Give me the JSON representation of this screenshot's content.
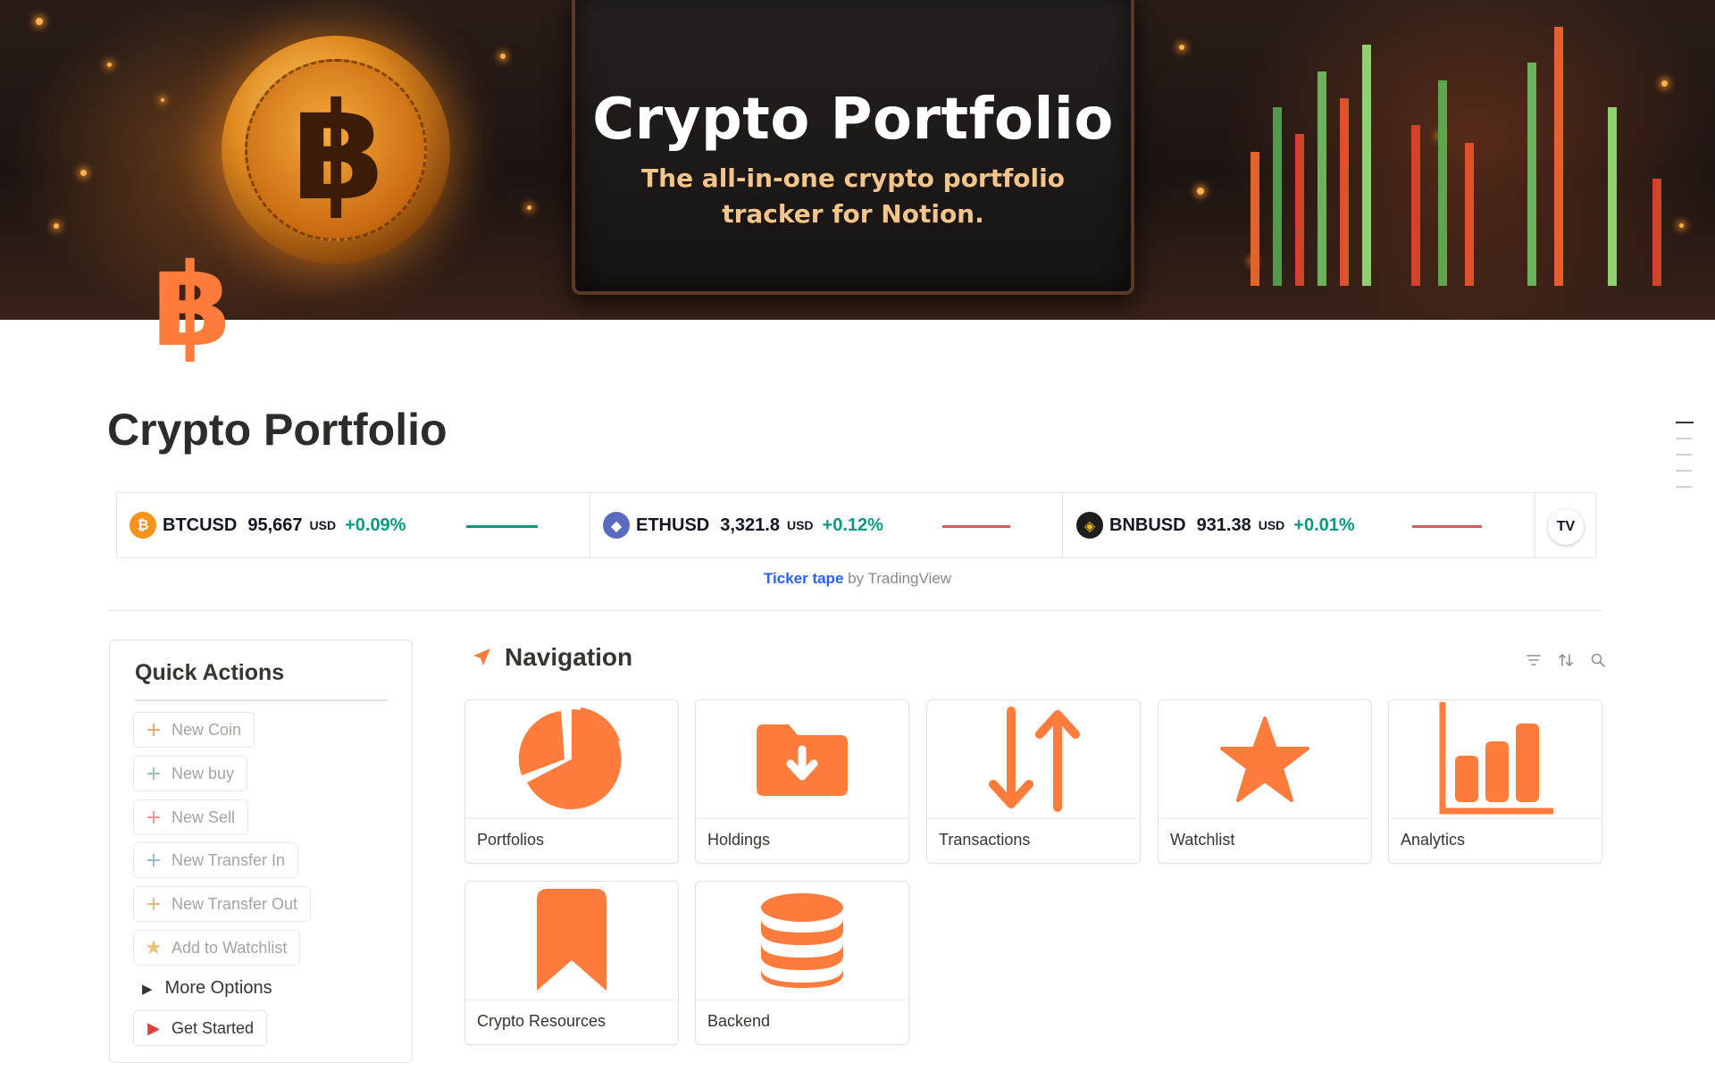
{
  "cover": {
    "title": "Crypto Portfolio",
    "subtitle_line1": "The all-in-one crypto portfolio",
    "subtitle_line2": "tracker for Notion."
  },
  "page": {
    "icon": "bitcoin-icon",
    "title": "Crypto Portfolio"
  },
  "ticker": {
    "items": [
      {
        "symbol": "BTCUSD",
        "price": "95,667",
        "unit": "USD",
        "change": "+0.09%",
        "logo": "bitcoin-logo",
        "logo_color": "#f7931a",
        "trend_color": "#089981"
      },
      {
        "symbol": "ETHUSD",
        "price": "3,321.8",
        "unit": "USD",
        "change": "+0.12%",
        "logo": "ethereum-logo",
        "logo_color": "#5a6bbf",
        "trend_color": "#f23645"
      },
      {
        "symbol": "BNBUSD",
        "price": "931.38",
        "unit": "USD",
        "change": "+0.01%",
        "logo": "binance-logo",
        "logo_color": "#1e1e1e",
        "trend_color": "#f23645"
      }
    ],
    "caption_link": "Ticker tape",
    "caption_rest": " by TradingView"
  },
  "quick_actions": {
    "title": "Quick Actions",
    "buttons": [
      {
        "label": "New Coin",
        "icon": "plus-icon",
        "color": "#e8a36b"
      },
      {
        "label": "New buy",
        "icon": "plus-icon",
        "color": "#8fbfae"
      },
      {
        "label": "New Sell",
        "icon": "plus-icon",
        "color": "#ea8e8e"
      },
      {
        "label": "New Transfer In",
        "icon": "plus-icon",
        "color": "#8fb8c9"
      },
      {
        "label": "New Transfer Out",
        "icon": "plus-icon",
        "color": "#e8b57a"
      },
      {
        "label": "Add to Watchlist",
        "icon": "star-icon",
        "color": "#efbf7c"
      }
    ],
    "more_options": "More Options",
    "get_started": "Get Started",
    "get_started_color": "#e03e3e"
  },
  "navigation": {
    "title": "Navigation",
    "accent": "#ff7c3c",
    "cards": [
      {
        "label": "Portfolios",
        "icon": "pie-chart-icon"
      },
      {
        "label": "Holdings",
        "icon": "folder-download-icon"
      },
      {
        "label": "Transactions",
        "icon": "swap-arrows-icon"
      },
      {
        "label": "Watchlist",
        "icon": "star-icon"
      },
      {
        "label": "Analytics",
        "icon": "bar-chart-icon"
      },
      {
        "label": "Crypto Resources",
        "icon": "bookmark-icon"
      },
      {
        "label": "Backend",
        "icon": "database-icon"
      }
    ]
  }
}
